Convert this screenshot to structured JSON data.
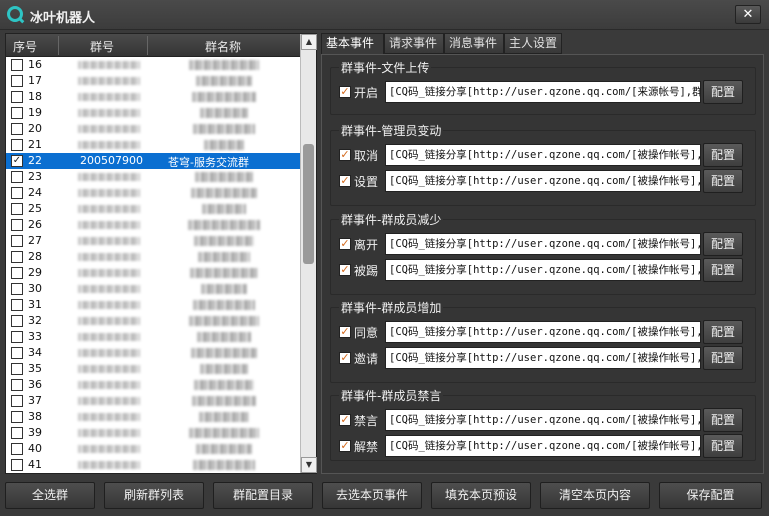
{
  "window": {
    "title": "冰叶机器人",
    "close_label": "✕"
  },
  "list": {
    "columns": [
      "序号",
      "群号",
      "群名称"
    ],
    "rows": [
      {
        "num": "16",
        "checked": false
      },
      {
        "num": "17",
        "checked": false
      },
      {
        "num": "18",
        "checked": false
      },
      {
        "num": "19",
        "checked": false
      },
      {
        "num": "20",
        "checked": false
      },
      {
        "num": "21",
        "checked": false
      },
      {
        "num": "22",
        "checked": true,
        "selected": true,
        "group_id": "200507900",
        "group_name": "苍穹-服务交流群"
      },
      {
        "num": "23",
        "checked": false
      },
      {
        "num": "24",
        "checked": false
      },
      {
        "num": "25",
        "checked": false
      },
      {
        "num": "26",
        "checked": false
      },
      {
        "num": "27",
        "checked": false
      },
      {
        "num": "28",
        "checked": false
      },
      {
        "num": "29",
        "checked": false
      },
      {
        "num": "30",
        "checked": false
      },
      {
        "num": "31",
        "checked": false
      },
      {
        "num": "32",
        "checked": false
      },
      {
        "num": "33",
        "checked": false
      },
      {
        "num": "34",
        "checked": false
      },
      {
        "num": "35",
        "checked": false
      },
      {
        "num": "36",
        "checked": false
      },
      {
        "num": "37",
        "checked": false
      },
      {
        "num": "38",
        "checked": false
      },
      {
        "num": "39",
        "checked": false
      },
      {
        "num": "40",
        "checked": false
      },
      {
        "num": "41",
        "checked": false
      }
    ]
  },
  "tabs": [
    {
      "label": "基本事件",
      "active": true
    },
    {
      "label": "请求事件",
      "active": false
    },
    {
      "label": "消息事件",
      "active": false
    },
    {
      "label": "主人设置",
      "active": false
    }
  ],
  "groups": [
    {
      "title": "群事件-文件上传",
      "rows": [
        {
          "label": "开启",
          "checked": true,
          "value": "[CQ码_链接分享[http://user.qzone.qq.com/[来源帐号],群"
        }
      ]
    },
    {
      "title": "群事件-管理员变动",
      "rows": [
        {
          "label": "取消",
          "checked": true,
          "value": "[CQ码_链接分享[http://user.qzone.qq.com/[被操作帐号],"
        },
        {
          "label": "设置",
          "checked": true,
          "value": "[CQ码_链接分享[http://user.qzone.qq.com/[被操作帐号],"
        }
      ]
    },
    {
      "title": "群事件-群成员减少",
      "rows": [
        {
          "label": "离开",
          "checked": true,
          "value": "[CQ码_链接分享[http://user.qzone.qq.com/[被操作帐号],"
        },
        {
          "label": "被踢",
          "checked": true,
          "value": "[CQ码_链接分享[http://user.qzone.qq.com/[被操作帐号],"
        }
      ]
    },
    {
      "title": "群事件-群成员增加",
      "rows": [
        {
          "label": "同意",
          "checked": true,
          "value": "[CQ码_链接分享[http://user.qzone.qq.com/[被操作帐号],"
        },
        {
          "label": "邀请",
          "checked": true,
          "value": "[CQ码_链接分享[http://user.qzone.qq.com/[被操作帐号],"
        }
      ]
    },
    {
      "title": "群事件-群成员禁言",
      "rows": [
        {
          "label": "禁言",
          "checked": true,
          "value": "[CQ码_链接分享[http://user.qzone.qq.com/[被操作帐号],"
        },
        {
          "label": "解禁",
          "checked": true,
          "value": "[CQ码_链接分享[http://user.qzone.qq.com/[被操作帐号],"
        }
      ]
    }
  ],
  "config_button_label": "配置",
  "bottom_buttons": [
    "全选群",
    "刷新群列表",
    "群配置目录",
    "去选本页事件",
    "填充本页预设",
    "清空本页内容",
    "保存配置"
  ],
  "colors": {
    "selection": "#0b6fd1",
    "check": "#d4691c",
    "icon": "#2ec4c4"
  }
}
